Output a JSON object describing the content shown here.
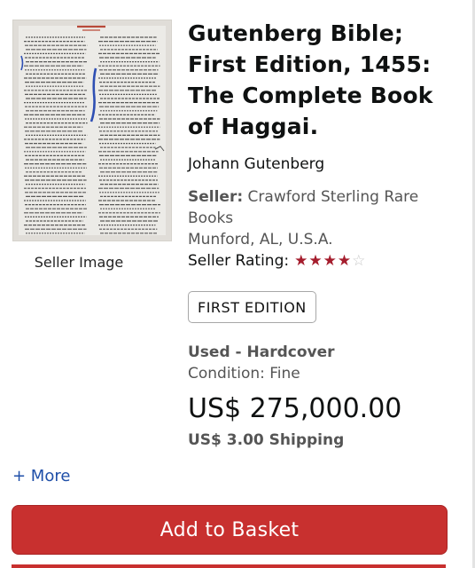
{
  "listing": {
    "image_caption": "Seller Image",
    "title": "Gutenberg Bible; First Edition, 1455: The Complete Book of Haggai.",
    "author": "Johann Gutenberg",
    "seller_label": "Seller:",
    "seller_name": "Crawford Sterling Rare Books",
    "seller_location": "Munford, AL, U.S.A.",
    "rating_label": "Seller Rating:",
    "rating_stars": 4,
    "rating_max": 5,
    "edition_badge": "FIRST EDITION",
    "binding": "Used - Hardcover",
    "condition": "Condition: Fine",
    "price": "US$ 275,000.00",
    "shipping": "US$ 3.00 Shipping"
  },
  "actions": {
    "more_link": "+ More",
    "add_to_basket": "Add to Basket"
  },
  "colors": {
    "button": "#c8302f",
    "star": "#a51d2d",
    "link": "#1f4fa8"
  }
}
